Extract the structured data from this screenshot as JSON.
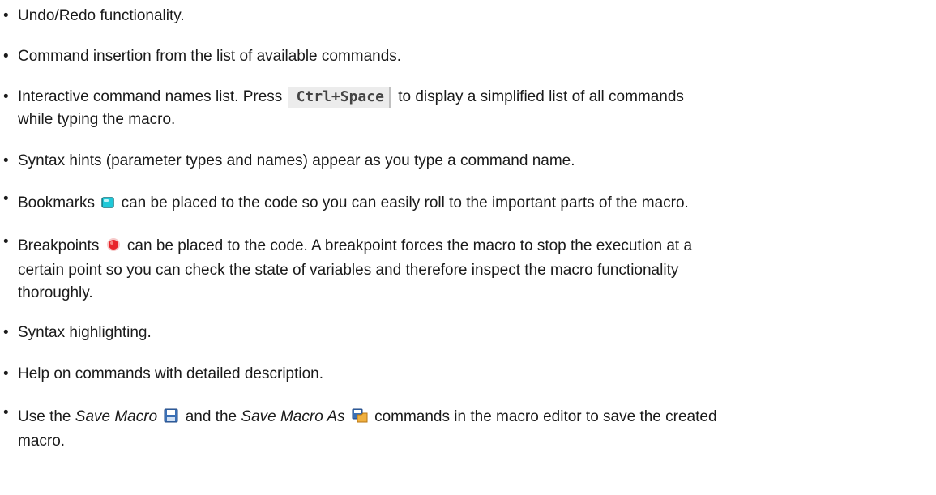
{
  "items": [
    {
      "text": "Undo/Redo functionality."
    },
    {
      "text": "Command insertion from the list of available commands."
    },
    {
      "before": "Interactive command names list. Press",
      "key": "Ctrl+Space",
      "after": "to display a simplified list of all commands",
      "line2": "while typing the macro."
    },
    {
      "text": "Syntax hints (parameter types and names) appear as you type a command name."
    },
    {
      "before": "Bookmarks",
      "icon": "bookmark-icon",
      "after": "can be placed to the code so you can easily roll to the important parts of the macro."
    },
    {
      "before": "Breakpoints",
      "icon": "breakpoint-icon",
      "after": "can be placed to the code. A breakpoint forces the macro to stop the execution at a",
      "line2": "certain point so you can check the state of variables and therefore inspect the macro functionality",
      "line3": "thoroughly."
    },
    {
      "text": "Syntax highlighting."
    },
    {
      "text": "Help on commands with detailed description."
    },
    {
      "pre": "Use the",
      "cmd1": "Save Macro",
      "icon1": "save-icon",
      "mid": "and the",
      "cmd2": "Save Macro As",
      "icon2": "save-as-icon",
      "post": "commands in the macro editor to save the created",
      "line2": "macro."
    }
  ],
  "colors": {
    "text": "#1a1a1a",
    "bookmark": "#1ec8d8",
    "breakpoint": "#e8242a",
    "save": "#3a6fb5",
    "save_as": "#e8a020"
  }
}
